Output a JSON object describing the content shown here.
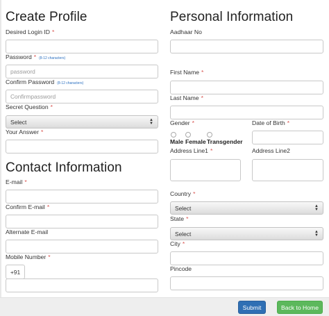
{
  "create_profile": {
    "title": "Create Profile",
    "login_id_label": "Desired Login ID",
    "password_label": "Password",
    "password_hint": "(8-12 characters)",
    "password_placeholder": "password",
    "confirm_password_label": "Confirm Password",
    "confirm_password_hint": "(8-12 characters)",
    "confirm_password_placeholder": "Confirmpassword",
    "secret_question_label": "Secret Question",
    "secret_question_value": "Select",
    "answer_label": "Your Answer"
  },
  "contact": {
    "title": "Contact Information",
    "email_label": "E-mail",
    "confirm_email_label": "Confirm E-mail",
    "alt_email_label": "Alternate E-mail",
    "mobile_label": "Mobile Number",
    "mobile_prefix": "+91"
  },
  "personal": {
    "title": "Personal Information",
    "aadhaar_label": "Aadhaar No",
    "first_name_label": "First Name",
    "last_name_label": "Last Name",
    "gender_label": "Gender",
    "gender_options": [
      "Male",
      "Female",
      "Transgender"
    ],
    "dob_label": "Date of Birth",
    "address1_label": "Address Line1",
    "address2_label": "Address Line2",
    "country_label": "Country",
    "country_value": "Select",
    "state_label": "State",
    "state_value": "Select",
    "city_label": "City",
    "pincode_label": "Pincode"
  },
  "required_marker": "*",
  "footer": {
    "submit_label": "Submit",
    "home_label": "Back to Home"
  },
  "colors": {
    "required": "#d9534f",
    "submit": "#2f6fb4",
    "home": "#5cb85c",
    "hint": "#2a6fc0"
  }
}
